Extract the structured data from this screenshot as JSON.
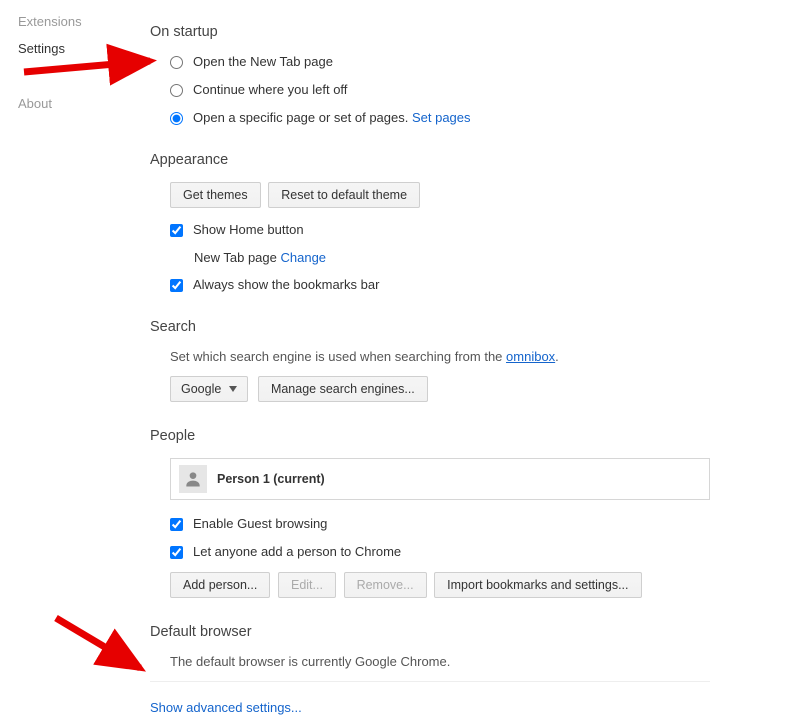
{
  "sidebar": {
    "items": [
      {
        "label": "Extensions"
      },
      {
        "label": "Settings"
      },
      {
        "label": "About"
      }
    ]
  },
  "startup": {
    "title": "On startup",
    "opt_newtab": "Open the New Tab page",
    "opt_continue": "Continue where you left off",
    "opt_specific": "Open a specific page or set of pages. ",
    "set_pages": "Set pages"
  },
  "appearance": {
    "title": "Appearance",
    "get_themes": "Get themes",
    "reset_theme": "Reset to default theme",
    "show_home": "Show Home button",
    "home_sub": "New Tab page ",
    "change": "Change",
    "always_bookmarks": "Always show the bookmarks bar"
  },
  "search": {
    "title": "Search",
    "desc_pre": "Set which search engine is used when searching from the ",
    "omnibox": "omnibox",
    "desc_post": ".",
    "engine": "Google",
    "manage": "Manage search engines..."
  },
  "people": {
    "title": "People",
    "person": "Person 1 (current)",
    "enable_guest": "Enable Guest browsing",
    "let_anyone": "Let anyone add a person to Chrome",
    "add": "Add person...",
    "edit": "Edit...",
    "remove": "Remove...",
    "import": "Import bookmarks and settings..."
  },
  "default_browser": {
    "title": "Default browser",
    "desc": "The default browser is currently Google Chrome."
  },
  "advanced": "Show advanced settings..."
}
